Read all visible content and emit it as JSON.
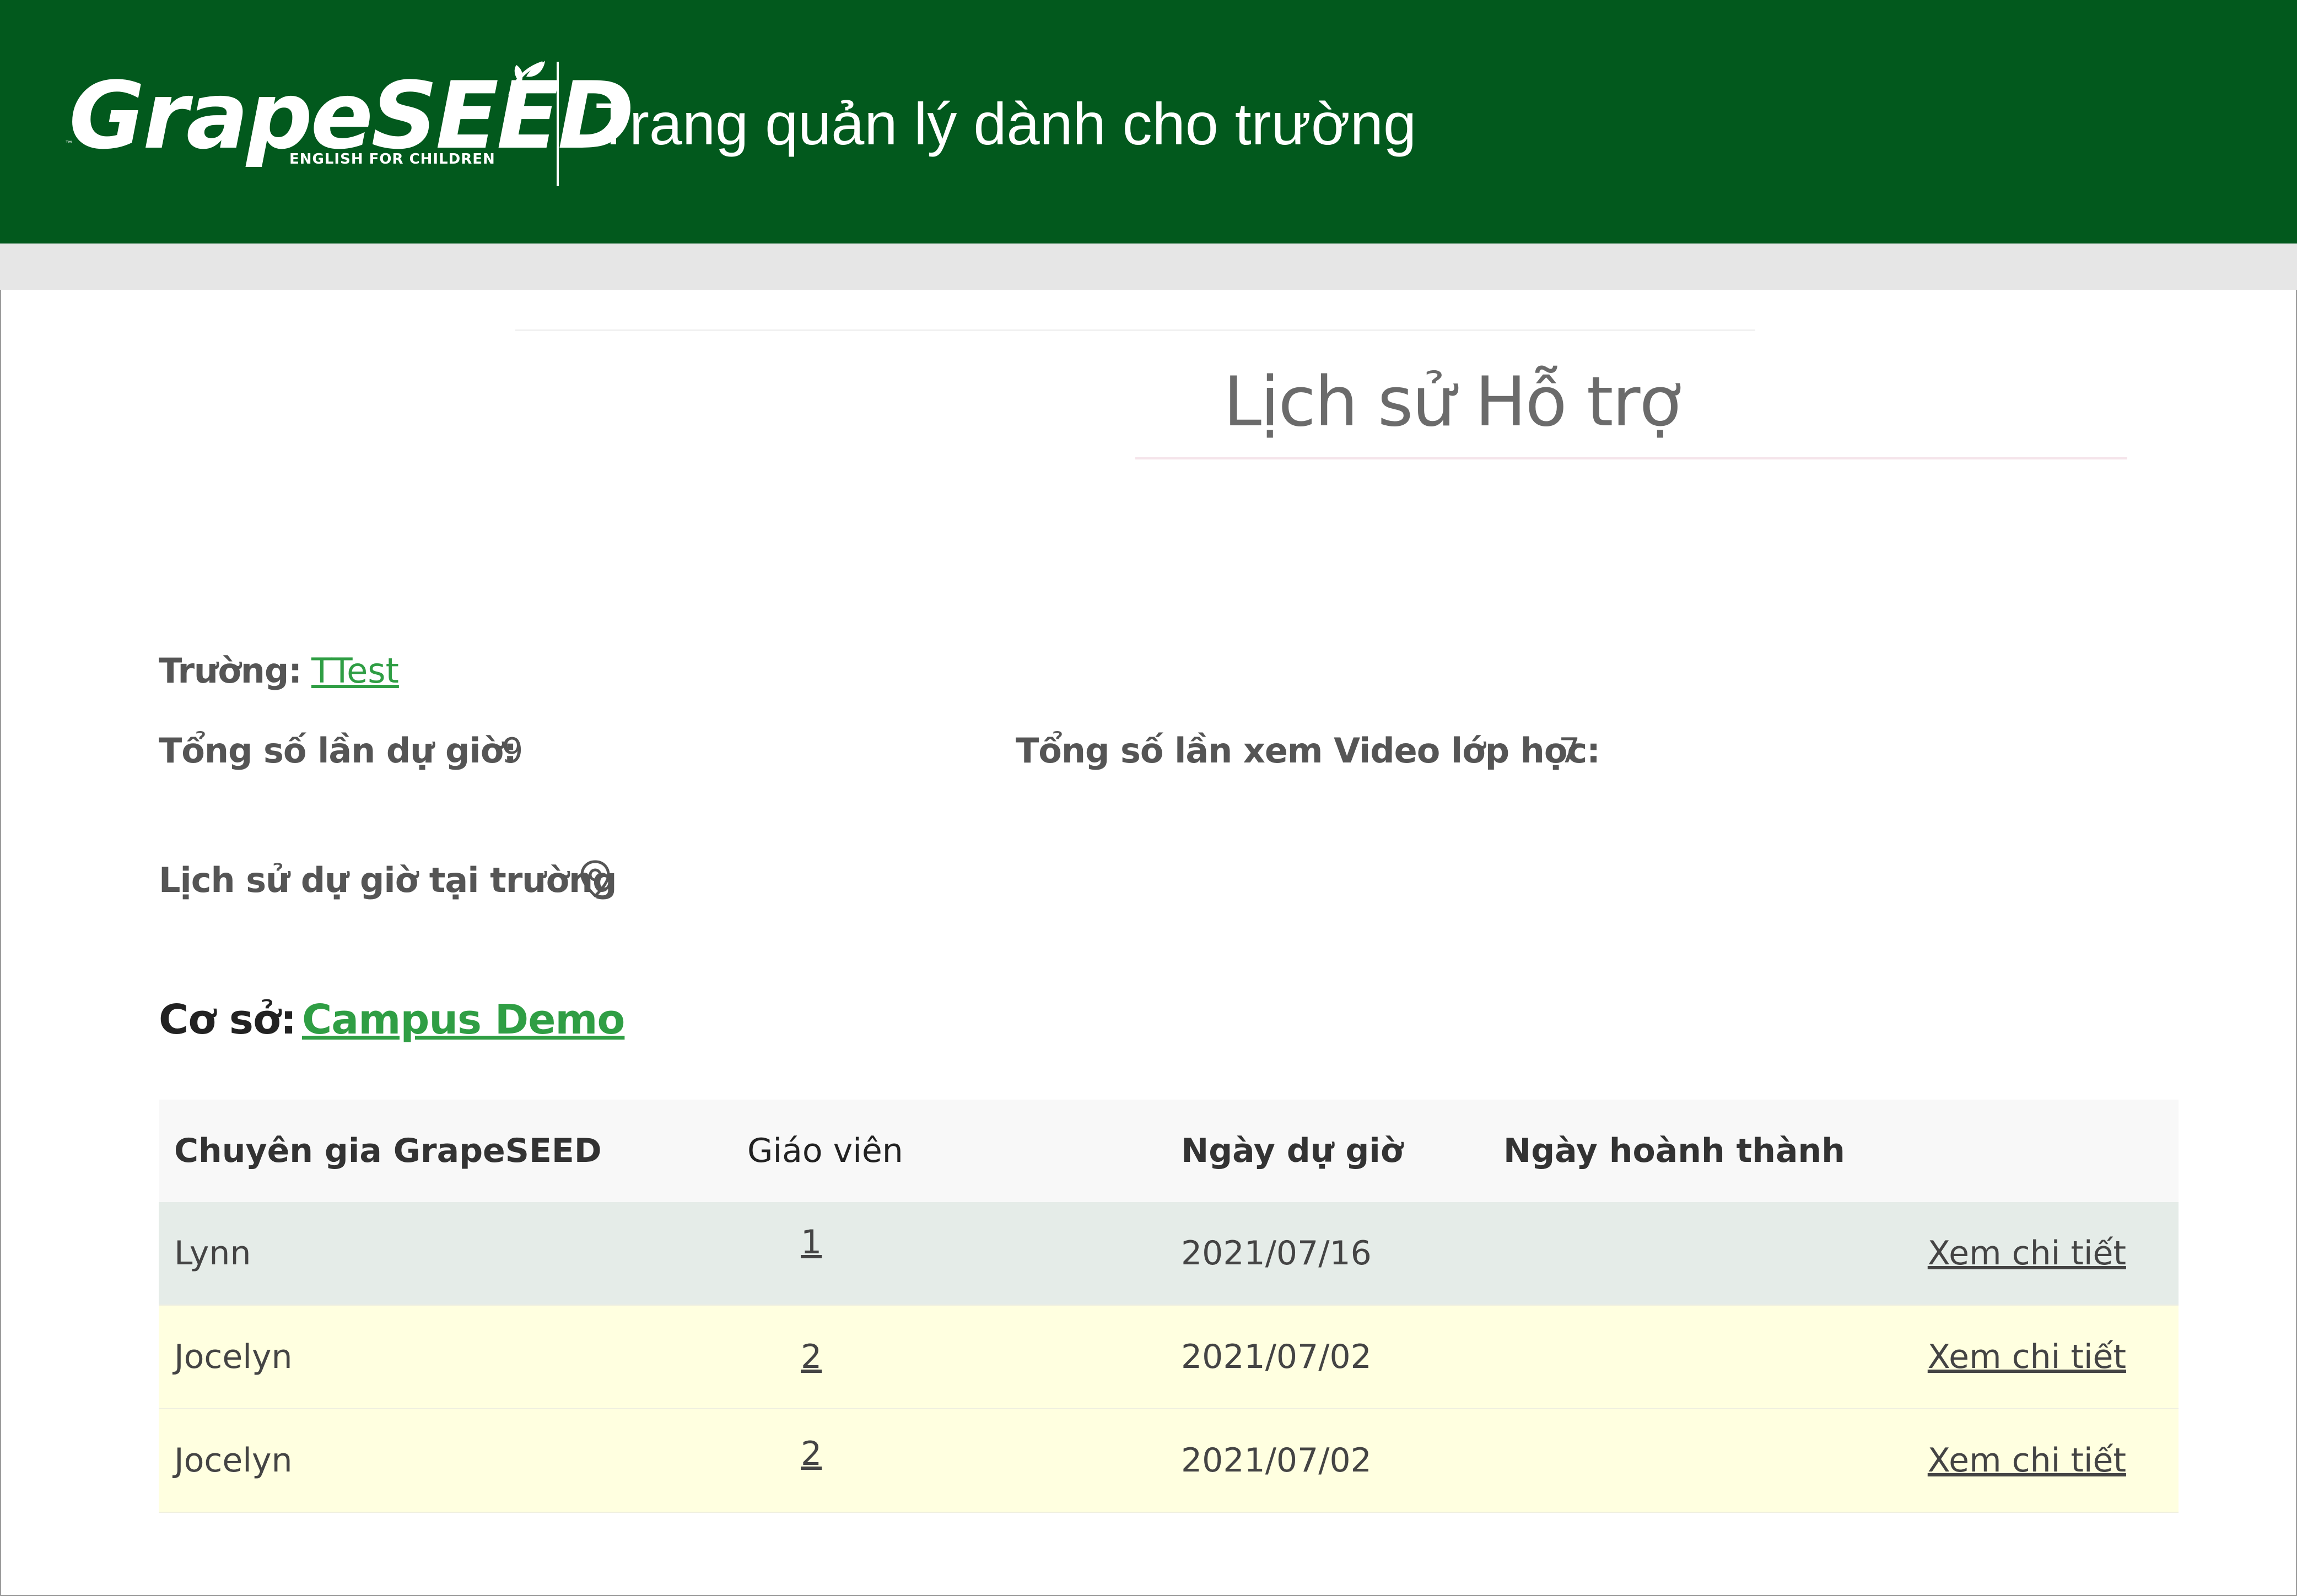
{
  "header": {
    "logo_text": "GrapeSEED",
    "logo_tagline": "ENGLISH FOR CHILDREN",
    "logo_tm": "™",
    "title": "Trang quản lý dành cho trường",
    "background_color": "#02591d"
  },
  "page": {
    "title": "Lịch sử Hỗ trợ"
  },
  "info": {
    "school_label": "Trường:",
    "school_value": "TTest",
    "visits_label": "Tổng số lần dự giờ:",
    "visits_value": "9",
    "video_label": "Tổng số lần xem Video lớp học:",
    "video_value": "7",
    "history_label": "Lịch sử dự giờ tại trường",
    "history_icon": "map-pin-icon"
  },
  "campus": {
    "label": "Cơ sở:",
    "value": "Campus Demo"
  },
  "table": {
    "headers": {
      "expert": "Chuyên gia GrapeSEED",
      "teacher": "Giáo viên",
      "visit_date": "Ngày dự giờ",
      "completed_date": "Ngày hoành thành"
    },
    "rows": [
      {
        "expert": "Lynn",
        "teacher": "1",
        "visit_date": "2021/07/16",
        "completed_date": "",
        "action": "Xem chi tiết"
      },
      {
        "expert": "Jocelyn",
        "teacher": "2",
        "visit_date": "2021/07/02",
        "completed_date": "",
        "action": "Xem chi tiết"
      },
      {
        "expert": "Jocelyn",
        "teacher": "2",
        "visit_date": "2021/07/02",
        "completed_date": "",
        "action": "Xem chi tiết"
      }
    ]
  },
  "colors": {
    "link": "#2f9e44",
    "row_highlight": "#e5ece8",
    "row_alt": "#ffffe0"
  }
}
